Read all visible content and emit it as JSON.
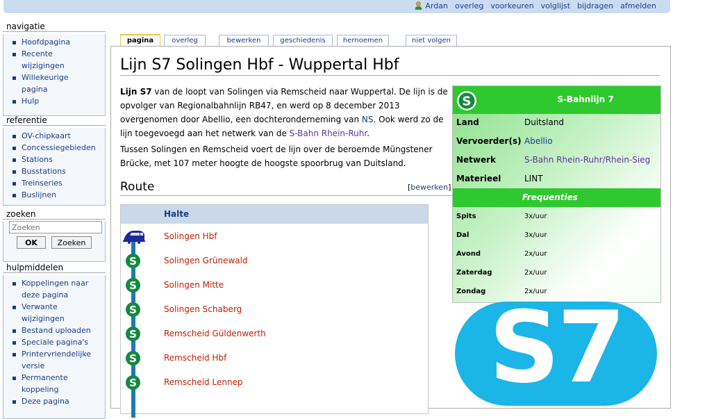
{
  "personal": {
    "user": "Ardan",
    "links": [
      "overleg",
      "voorkeuren",
      "volglijst",
      "bijdragen",
      "afmelden"
    ]
  },
  "sidebar": {
    "navigatie": {
      "title": "navigatie",
      "items": [
        "Hoofdpagina",
        "Recente",
        "wijzigingen",
        "Willekeurige",
        "pagina",
        "Hulp"
      ]
    },
    "referentie": {
      "title": "referentie",
      "items": [
        "OV-chipkaart",
        "Concessiegebieden",
        "Stations",
        "Busstations",
        "Treinseries",
        "Buslijnen"
      ]
    },
    "zoeken": {
      "title": "zoeken",
      "placeholder": "Zoeken",
      "ok": "OK",
      "search": "Zoeken"
    },
    "hulpmiddelen": {
      "title": "hulpmiddelen",
      "items": [
        "Koppelingen naar",
        "deze pagina",
        "Verwante",
        "wijzigingen",
        "Bestand uploaden",
        "Speciale pagina's",
        "Printervriendelijke",
        "versie",
        "Permanente",
        "koppeling",
        "Deze pagina"
      ]
    }
  },
  "tabs": [
    "pagina",
    "overleg",
    "bewerken",
    "geschiedenis",
    "hernoemen",
    "niet volgen"
  ],
  "page": {
    "title": "Lijn S7 Solingen Hbf - Wuppertal Hbf",
    "intro": {
      "bold": "Lijn S7",
      "part1": " van de loopt van Solingen via Remscheid naar Wuppertal. De lijn is de opvolger van Regionalbahnlijn RB47, en werd op 8 december 2013 overgenomen door Abellio, een dochteronderneming van ",
      "link1": "NS",
      "part2": ". Ook werd zo de lijn toegevoegd aan het netwerk van de ",
      "link2": "S-Bahn Rhein-Ruhr",
      "part3": "."
    },
    "para2": "Tussen Solingen en Remscheid voert de lijn over de beroemde Müngstener Brücke, met 107 meter hoogte de hoogste spoorbrug van Duitsland.",
    "route_heading": "Route",
    "edit_open": "[",
    "edit_label": "bewerken",
    "edit_close": "]",
    "route_header": "Halte",
    "stops": [
      "Solingen Hbf",
      "Solingen Grünewald",
      "Solingen Mitte",
      "Solingen Schaberg",
      "Remscheid Güldenwerth",
      "Remscheid Hbf",
      "Remscheid Lennep"
    ]
  },
  "infobox": {
    "title": "S-Bahnlijn 7",
    "rows": [
      {
        "label": "Land",
        "value": "Duitsland"
      },
      {
        "label": "Vervoerder(s)",
        "value": "Abellio"
      },
      {
        "label": "Netwerk",
        "value": "S-Bahn Rhein-Ruhr/Rhein-Sieg"
      },
      {
        "label": "Materieel",
        "value": "LINT"
      }
    ],
    "freq_title": "Frequenties",
    "freq": [
      {
        "label": "Spits",
        "value": "3x/uur"
      },
      {
        "label": "Dal",
        "value": "3x/uur"
      },
      {
        "label": "Avond",
        "value": "2x/uur"
      },
      {
        "label": "Zaterdag",
        "value": "2x/uur"
      },
      {
        "label": "Zondag",
        "value": "2x/uur"
      }
    ]
  },
  "logo_text": "S7",
  "colors": {
    "link": "#1a3c84",
    "visited": "#5a3696",
    "stop": "#c02000",
    "infobox_band": "#2ec92e",
    "s_badge": "#138a3e",
    "logo_bg": "#1bb5e8"
  }
}
